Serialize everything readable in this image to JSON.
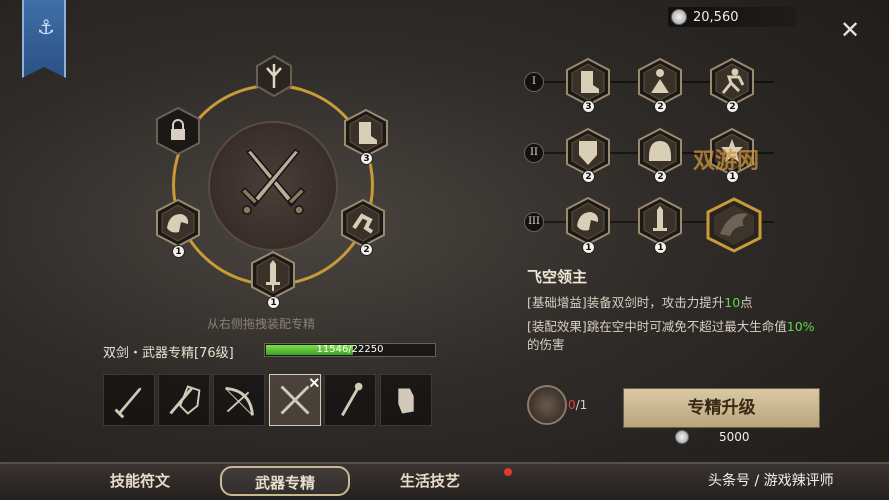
{
  "currency": {
    "amount": "20,560"
  },
  "ring": {
    "badges": {
      "top_right": "3",
      "right": "2",
      "bottom": "1",
      "left": "1"
    }
  },
  "drag_hint": "从右侧拖拽装配专精",
  "weapon": {
    "title": "双剑・武器专精[76级]",
    "xp": "11546/22250",
    "xp_progress": 0.519
  },
  "tiers": [
    {
      "label": "I",
      "counts": [
        "3",
        "2",
        "2"
      ]
    },
    {
      "label": "II",
      "counts": [
        "2",
        "2",
        "1"
      ]
    },
    {
      "label": "III",
      "counts": [
        "1",
        "1"
      ]
    }
  ],
  "skill": {
    "name": "飞空领主",
    "line1_prefix": "[基础增益]装备双剑时，攻击力提升",
    "line1_value": "10",
    "line1_suffix": "点",
    "line2_prefix": "[装配效果]跳在空中时可减免不超过最大生命值",
    "line2_value": "10%",
    "line2_suffix": "的伤害"
  },
  "material": {
    "have": "0",
    "need": "/1"
  },
  "upgrade": {
    "label": "专精升级",
    "cost": "5000"
  },
  "tabs": [
    "技能符文",
    "武器专精",
    "生活技艺"
  ],
  "watermark": "头条号 / 游戏辣评师",
  "watermark2": "双游网",
  "colors": {
    "ring": "#c99a38",
    "accent_green": "#5fd84a",
    "banner": "#3f6fa8"
  }
}
